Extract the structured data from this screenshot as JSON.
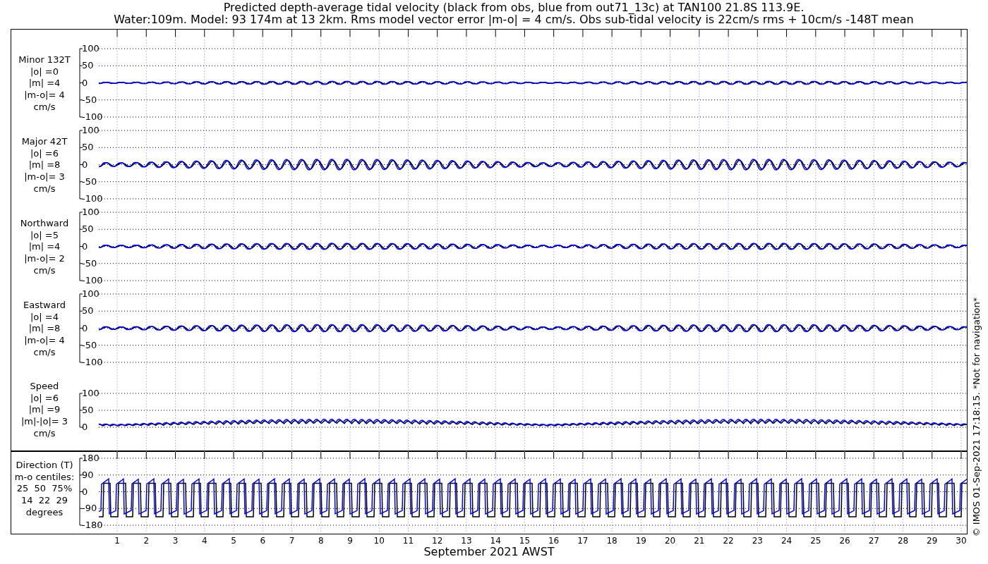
{
  "title": {
    "line_1": "Predicted depth-average tidal velocity (black from obs, blue from out71_13c) at TAN100 21.8S 113.9E.",
    "line_2": "Water:109m. Model: 93 174m at 13 2km. Rms model vector error |m-o| = 4 cm/s. Obs sub-tidal velocity is 22cm/s rms + 10cm/s -148T mean"
  },
  "panels": [
    {
      "label_lines": [
        "Minor 132T",
        "|o| =0",
        "|m| =4",
        "|m-o|= 4",
        "cm/s"
      ],
      "yticks": [
        "100",
        "50",
        "0",
        "-50",
        "-100"
      ]
    },
    {
      "label_lines": [
        "Major 42T",
        "|o| =6",
        "|m| =8",
        "|m-o|= 3",
        "cm/s"
      ],
      "yticks": [
        "100",
        "50",
        "0",
        "-50",
        "-100"
      ]
    },
    {
      "label_lines": [
        "Northward",
        "|o| =5",
        "|m| =4",
        "|m-o|= 2",
        "cm/s"
      ],
      "yticks": [
        "100",
        "50",
        "0",
        "-50",
        "-100"
      ]
    },
    {
      "label_lines": [
        "Eastward",
        "|o| =4",
        "|m| =8",
        "|m-o|= 4",
        "cm/s"
      ],
      "yticks": [
        "100",
        "50",
        "0",
        "-50",
        "-100"
      ]
    },
    {
      "label_lines": [
        "Speed",
        "|o| =6",
        "|m| =9",
        "|m|-|o|= 3",
        "cm/s"
      ],
      "yticks": [
        "100",
        "50",
        "0"
      ]
    }
  ],
  "direction_panel": {
    "label_lines": [
      "Direction (T)",
      "m-o centiles:",
      "25  50  75%",
      "14  22  29",
      "degrees"
    ],
    "yticks": [
      "180",
      "90",
      "0",
      "-90",
      "-180"
    ]
  },
  "x_axis": {
    "ticks": [
      "1",
      "2",
      "3",
      "4",
      "5",
      "6",
      "7",
      "8",
      "9",
      "10",
      "11",
      "12",
      "13",
      "14",
      "15",
      "16",
      "17",
      "18",
      "19",
      "20",
      "21",
      "22",
      "23",
      "24",
      "25",
      "26",
      "27",
      "28",
      "29",
      "30"
    ],
    "label": "September 2021 AWST"
  },
  "credit": "© IMOS 01-Sep-2021 17:18:15. *Not for navigation*"
}
